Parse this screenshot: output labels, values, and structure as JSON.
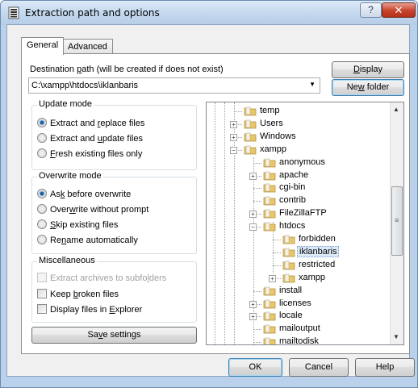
{
  "window": {
    "title": "Extraction path and options",
    "help_glyph": "?",
    "close_glyph": "✕"
  },
  "tabs": [
    {
      "label": "General",
      "active": true
    },
    {
      "label": "Advanced",
      "active": false
    }
  ],
  "destination": {
    "label_pre": "Destination ",
    "label_accel": "p",
    "label_post": "ath (will be created if does not exist)",
    "value": "C:\\xampp\\htdocs\\iklanbaris",
    "display_button": {
      "pre": "",
      "accel": "D",
      "post": "isplay"
    },
    "new_folder_button": {
      "pre": "Ne",
      "accel": "w",
      "post": " folder"
    }
  },
  "update_mode": {
    "title": "Update mode",
    "options": [
      {
        "pre": "Extract and ",
        "accel": "r",
        "post": "eplace files",
        "selected": true
      },
      {
        "pre": "Extract and ",
        "accel": "u",
        "post": "pdate files",
        "selected": false
      },
      {
        "pre": "",
        "accel": "F",
        "post": "resh existing files only",
        "selected": false
      }
    ]
  },
  "overwrite_mode": {
    "title": "Overwrite mode",
    "options": [
      {
        "pre": "As",
        "accel": "k",
        "post": " before overwrite",
        "selected": true
      },
      {
        "pre": "Over",
        "accel": "w",
        "post": "rite without prompt",
        "selected": false
      },
      {
        "pre": "",
        "accel": "S",
        "post": "kip existing files",
        "selected": false
      },
      {
        "pre": "Re",
        "accel": "n",
        "post": "ame automatically",
        "selected": false
      }
    ]
  },
  "misc": {
    "title": "Miscellaneous",
    "options": [
      {
        "pre": "Extract archives to subfo",
        "accel": "l",
        "post": "ders",
        "checked": false,
        "disabled": true
      },
      {
        "pre": "Keep ",
        "accel": "b",
        "post": "roken files",
        "checked": false,
        "disabled": false
      },
      {
        "pre": "Display files in ",
        "accel": "E",
        "post": "xplorer",
        "checked": false,
        "disabled": false
      }
    ]
  },
  "save_button": {
    "pre": "Sa",
    "accel": "v",
    "post": "e settings"
  },
  "tree": {
    "rows": [
      {
        "label": "temp",
        "level": 0,
        "expander": "",
        "selected": false
      },
      {
        "label": "Users",
        "level": 0,
        "expander": "+",
        "selected": false
      },
      {
        "label": "Windows",
        "level": 0,
        "expander": "+",
        "selected": false
      },
      {
        "label": "xampp",
        "level": 0,
        "expander": "−",
        "selected": false
      },
      {
        "label": "anonymous",
        "level": 1,
        "expander": "",
        "selected": false
      },
      {
        "label": "apache",
        "level": 1,
        "expander": "+",
        "selected": false
      },
      {
        "label": "cgi-bin",
        "level": 1,
        "expander": "",
        "selected": false
      },
      {
        "label": "contrib",
        "level": 1,
        "expander": "",
        "selected": false
      },
      {
        "label": "FileZillaFTP",
        "level": 1,
        "expander": "+",
        "selected": false
      },
      {
        "label": "htdocs",
        "level": 1,
        "expander": "−",
        "selected": false
      },
      {
        "label": "forbidden",
        "level": 2,
        "expander": "",
        "selected": false
      },
      {
        "label": "iklanbaris",
        "level": 2,
        "expander": "",
        "selected": true
      },
      {
        "label": "restricted",
        "level": 2,
        "expander": "",
        "selected": false
      },
      {
        "label": "xampp",
        "level": 2,
        "expander": "+",
        "selected": false
      },
      {
        "label": "install",
        "level": 1,
        "expander": "",
        "selected": false
      },
      {
        "label": "licenses",
        "level": 1,
        "expander": "+",
        "selected": false
      },
      {
        "label": "locale",
        "level": 1,
        "expander": "+",
        "selected": false
      },
      {
        "label": "mailoutput",
        "level": 1,
        "expander": "",
        "selected": false
      },
      {
        "label": "mailtodisk",
        "level": 1,
        "expander": "",
        "selected": false
      }
    ],
    "scroll_glyph": "≡"
  },
  "footer": {
    "ok": "OK",
    "cancel": "Cancel",
    "help": "Help"
  },
  "colors": {
    "accent": "#3c7fb1",
    "folder": "#e8c66a",
    "selection": "#dceaf8"
  }
}
